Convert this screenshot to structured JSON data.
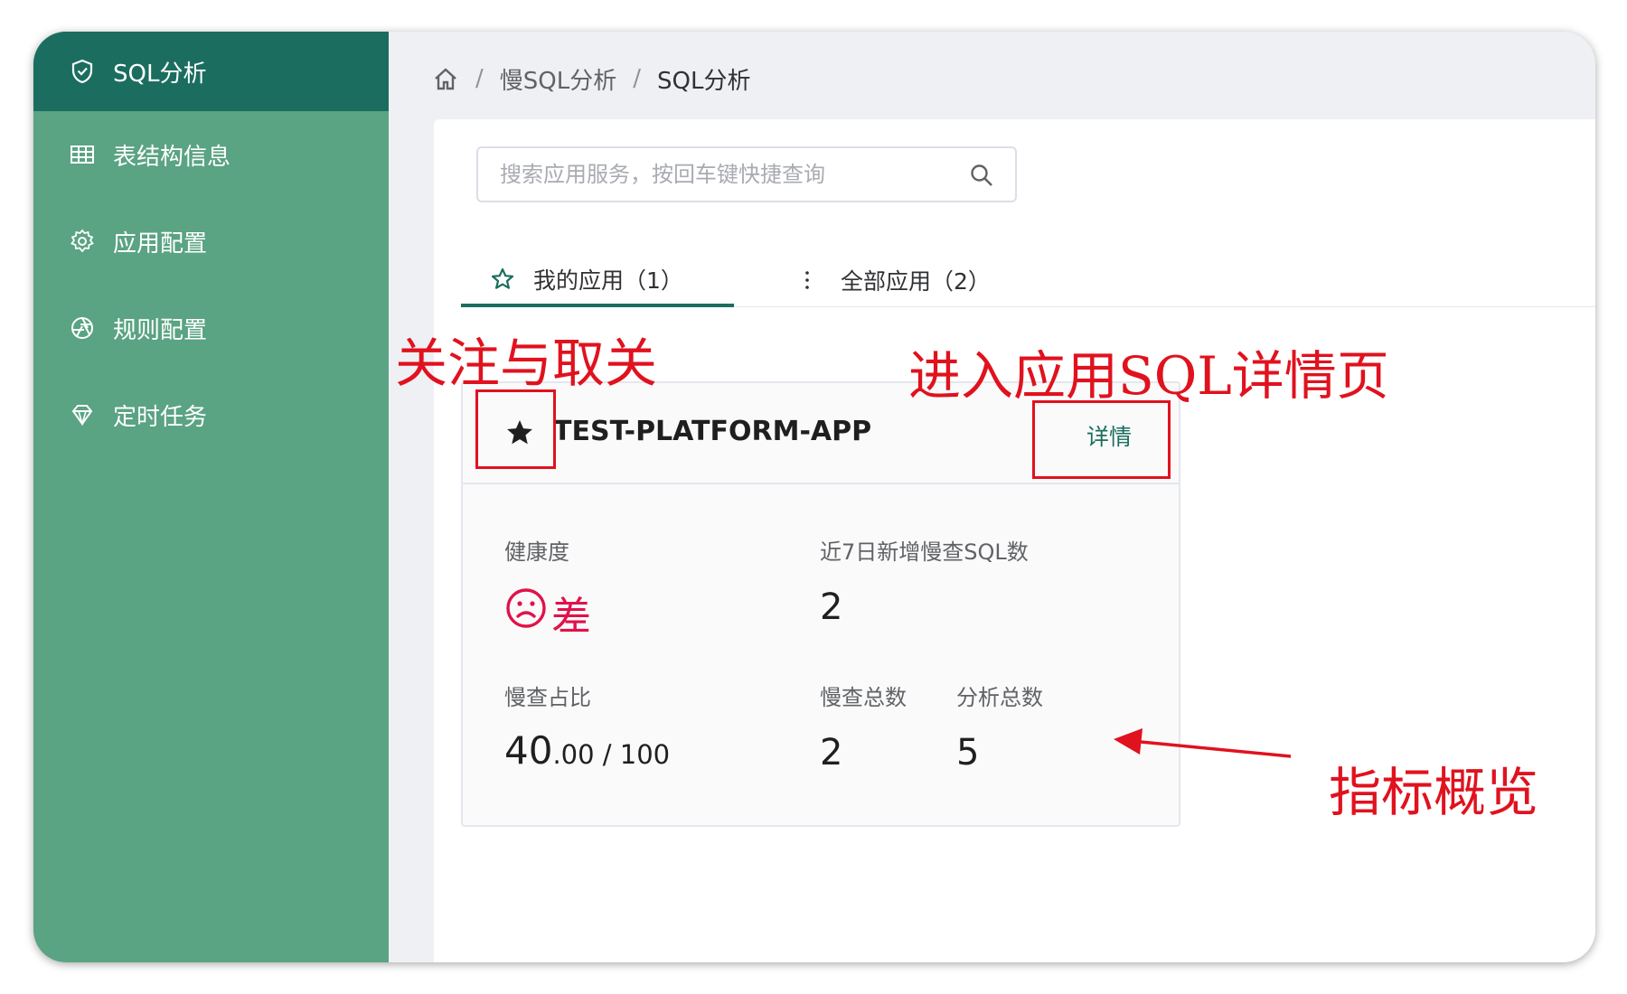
{
  "sidebar": {
    "items": [
      {
        "label": "SQL分析",
        "icon": "shield-check-icon",
        "active": true
      },
      {
        "label": "表结构信息",
        "icon": "table-icon"
      },
      {
        "label": "应用配置",
        "icon": "gear-icon"
      },
      {
        "label": "规则配置",
        "icon": "aperture-icon"
      },
      {
        "label": "定时任务",
        "icon": "diamond-icon"
      }
    ]
  },
  "breadcrumb": {
    "home_icon": "home-icon",
    "sep1": "/",
    "level1": "慢SQL分析",
    "sep2": "/",
    "level2": "SQL分析"
  },
  "search": {
    "placeholder": "搜索应用服务，按回车键快捷查询",
    "value": "",
    "icon": "search-icon"
  },
  "tabs": [
    {
      "label": "我的应用（1）",
      "icon": "star-outline-icon",
      "active": true
    },
    {
      "label": "全部应用（2）",
      "icon": "more-vertical-icon",
      "active": false
    }
  ],
  "app_card": {
    "name": "TEST-PLATFORM-APP",
    "favorite": true,
    "detail_label": "详情",
    "health_label": "健康度",
    "health_value": "差",
    "health_icon": "sad-face-icon",
    "new_slow_label": "近7日新增慢查SQL数",
    "new_slow_value": "2",
    "ratio_label": "慢查占比",
    "ratio_main": "40",
    "ratio_decimal": ".00",
    "ratio_total": " / 100",
    "slow_total_label": "慢查总数",
    "slow_total_value": "2",
    "analysis_total_label": "分析总数",
    "analysis_total_value": "5"
  },
  "annotations": {
    "follow": "关注与取关",
    "detail": "进入应用SQL详情页",
    "overview": "指标概览"
  },
  "colors": {
    "sidebar_bg": "#5aa383",
    "sidebar_active": "#1b6e5f",
    "accent": "#1b6e5f",
    "danger": "#e0124a",
    "annotation": "#e0121e"
  }
}
